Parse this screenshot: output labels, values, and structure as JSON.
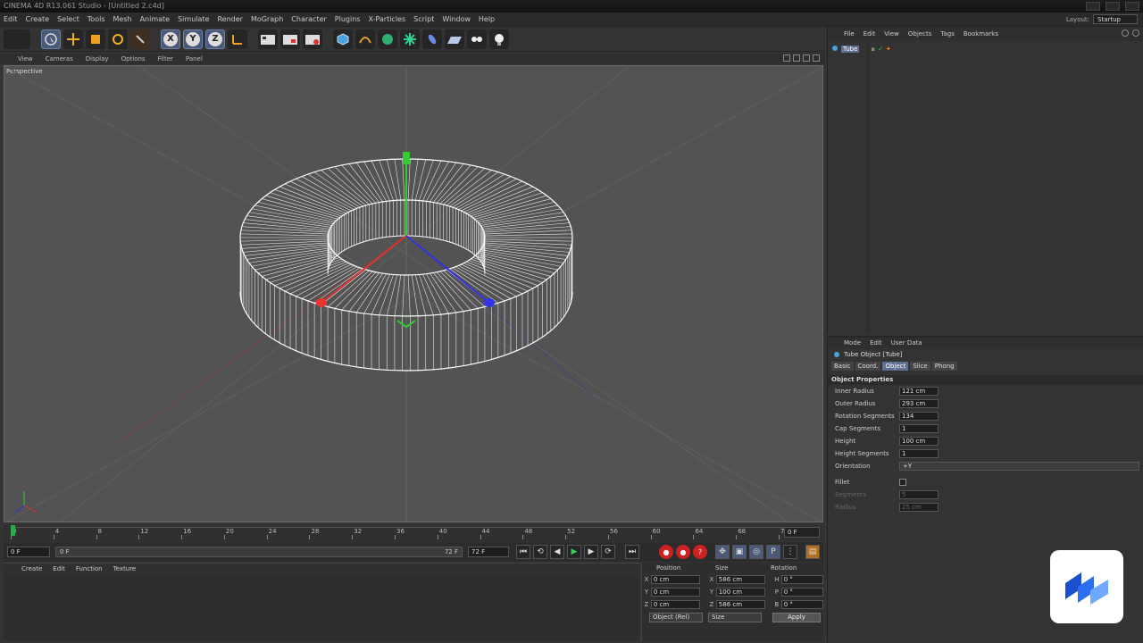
{
  "window": {
    "title": "CINEMA 4D R13.061 Studio - [Untitled 2.c4d]"
  },
  "menu": [
    "Edit",
    "Create",
    "Select",
    "Tools",
    "Mesh",
    "Animate",
    "Simulate",
    "Render",
    "MoGraph",
    "Character",
    "Plugins",
    "X-Particles",
    "Script",
    "Window",
    "Help"
  ],
  "layout": {
    "label": "Layout:",
    "value": "Startup"
  },
  "viewport": {
    "menu": [
      "View",
      "Cameras",
      "Display",
      "Options",
      "Filter",
      "Panel"
    ],
    "label": "Perspective"
  },
  "timeline": {
    "ticks": [
      "0",
      "4",
      "8",
      "12",
      "16",
      "20",
      "24",
      "28",
      "32",
      "36",
      "40",
      "44",
      "48",
      "52",
      "56",
      "60",
      "64",
      "68",
      "72"
    ],
    "end_frame": "0 F"
  },
  "transport": {
    "start": "0 F",
    "range_in": "0 F",
    "range_out": "72 F",
    "end": "72 F"
  },
  "material_panel": {
    "menu": [
      "Create",
      "Edit",
      "Function",
      "Texture"
    ]
  },
  "coordinates": {
    "headers": [
      "Position",
      "Size",
      "Rotation"
    ],
    "rows": [
      {
        "axis": "X",
        "pos": "0 cm",
        "size_axis": "X",
        "size": "586 cm",
        "rot_axis": "H",
        "rot": "0 °"
      },
      {
        "axis": "Y",
        "pos": "0 cm",
        "size_axis": "Y",
        "size": "100 cm",
        "rot_axis": "P",
        "rot": "0 °"
      },
      {
        "axis": "Z",
        "pos": "0 cm",
        "size_axis": "Z",
        "size": "586 cm",
        "rot_axis": "B",
        "rot": "0 °"
      }
    ],
    "mode": "Object (Rel)",
    "size_mode": "Size",
    "apply": "Apply"
  },
  "object_manager": {
    "menu": [
      "File",
      "Edit",
      "View",
      "Objects",
      "Tags",
      "Bookmarks"
    ],
    "objects": [
      {
        "name": "Tube"
      }
    ]
  },
  "attributes": {
    "menu": [
      "Mode",
      "Edit",
      "User Data"
    ],
    "title": "Tube Object [Tube]",
    "tabs": [
      "Basic",
      "Coord.",
      "Object",
      "Slice",
      "Phong"
    ],
    "active_tab": "Object",
    "section": "Object Properties",
    "props": [
      {
        "label": "Inner Radius",
        "value": "121 cm"
      },
      {
        "label": "Outer Radius",
        "value": "293 cm"
      },
      {
        "label": "Rotation Segments",
        "value": "134"
      },
      {
        "label": "Cap Segments",
        "value": "1"
      },
      {
        "label": "Height",
        "value": "100 cm"
      },
      {
        "label": "Height Segments",
        "value": "1"
      }
    ],
    "orientation": {
      "label": "Orientation",
      "value": "+Y"
    },
    "fillet": {
      "label": "Fillet"
    },
    "fillet_props": [
      {
        "label": "Segments",
        "value": "5"
      },
      {
        "label": "Radius",
        "value": "25 cm"
      }
    ]
  },
  "colors": {
    "accent": "#5f6f94",
    "viewport_bg": "#535353",
    "play_green": "#3bd15a"
  }
}
